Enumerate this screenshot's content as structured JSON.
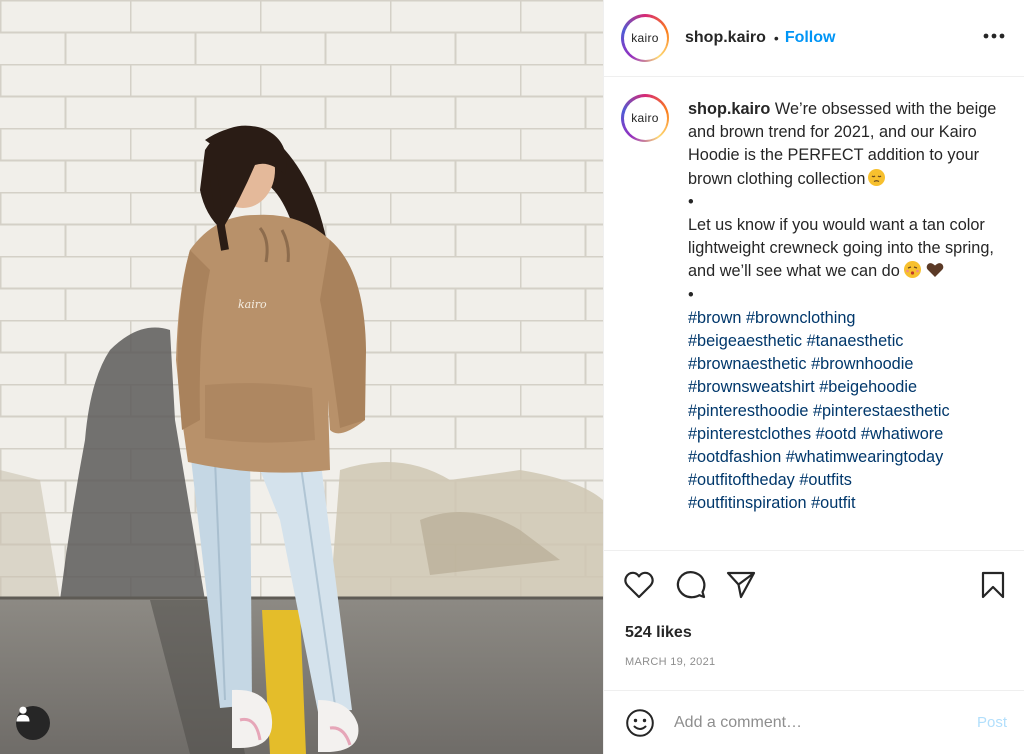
{
  "post": {
    "account": "shop.kairo",
    "avatar_text": "kairo",
    "follow_label": "Follow",
    "separator": "•",
    "image_alt": "Woman in a tan Kairo hoodie and light blue jeans standing against a white brick wall",
    "hoodie_print": "kairo"
  },
  "caption": {
    "user": "shop.kairo",
    "intro": "We’re obsessed with the beige and brown trend for 2021, and our Kairo Hoodie is the PERFECT addition to your brown clothing collection",
    "bullet1": "•",
    "ask": "Let us know if you would want a tan color lightweight crewneck going into the spring, and we’ll see what we can do",
    "bullet2": "•",
    "hashtags": [
      "#brown",
      "#brownclothing",
      "#beigeaesthetic",
      "#tanaesthetic",
      "#brownaesthetic",
      "#brownhoodie",
      "#brownsweatshirt",
      "#beigehoodie",
      "#pinteresthoodie",
      "#pinterestaesthetic",
      "#pinterestclothes",
      "#ootd",
      "#whatiwore",
      "#ootdfashion",
      "#whatimwearingtoday",
      "#outfitoftheday",
      "#outfits",
      "#outfitinspiration",
      "#outfit"
    ]
  },
  "stats": {
    "likes": "524 likes",
    "date": "MARCH 19, 2021"
  },
  "comment": {
    "placeholder": "Add a comment…",
    "post_label": "Post"
  },
  "icons": {
    "like": "heart-icon",
    "comment": "speech-bubble-icon",
    "share": "paper-plane-icon",
    "save": "bookmark-icon",
    "more": "ellipsis-icon",
    "emoji": "smiley-icon",
    "tags": "user-icon"
  },
  "colors": {
    "follow": "#0095f6",
    "hashtag": "#00376b",
    "muted": "#8e8e8e",
    "post_disabled": "#b2dffc"
  }
}
